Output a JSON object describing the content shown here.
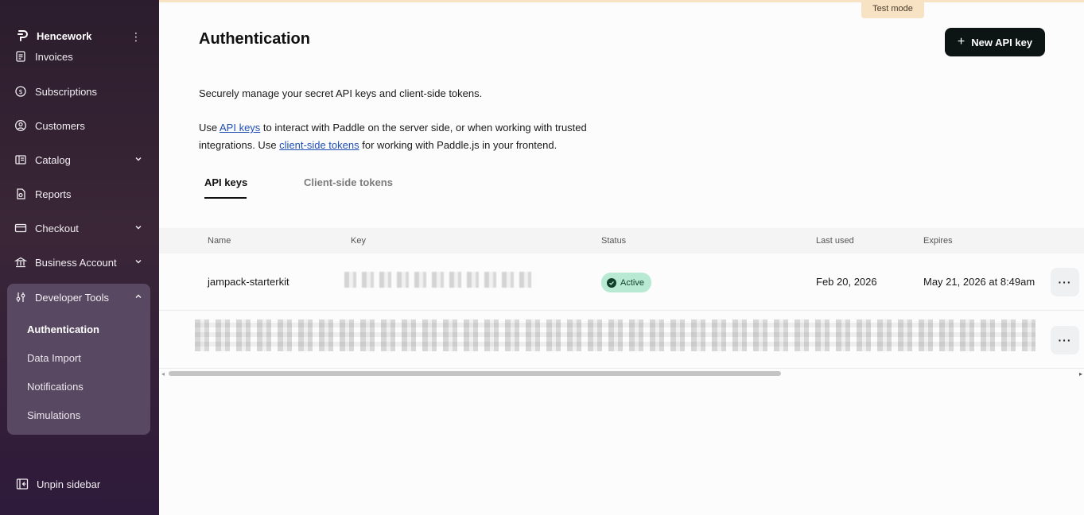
{
  "sidebar": {
    "brand": "Hencework",
    "items": [
      {
        "label": "Invoices"
      },
      {
        "label": "Subscriptions"
      },
      {
        "label": "Customers"
      },
      {
        "label": "Catalog"
      },
      {
        "label": "Reports"
      },
      {
        "label": "Checkout"
      },
      {
        "label": "Business Account"
      },
      {
        "label": "Developer Tools"
      }
    ],
    "sub_items": [
      {
        "label": "Authentication"
      },
      {
        "label": "Data Import"
      },
      {
        "label": "Notifications"
      },
      {
        "label": "Simulations"
      }
    ],
    "unpin_label": "Unpin sidebar"
  },
  "header": {
    "test_mode": "Test mode",
    "title": "Authentication",
    "new_key_button": "New API key"
  },
  "description": {
    "line1": "Securely manage your secret API keys and client-side tokens.",
    "line2_prefix": "Use ",
    "line2_link": "API keys",
    "line2_suffix": " to interact with Paddle on the server side, or when working with trusted",
    "line3_prefix": "integrations. Use ",
    "line3_link": "client-side tokens",
    "line3_suffix": " for working with Paddle.js in your frontend."
  },
  "tabs": [
    {
      "label": "API keys",
      "active": true
    },
    {
      "label": "Client-side tokens",
      "active": false
    }
  ],
  "table": {
    "columns": [
      "Name",
      "Key",
      "Status",
      "Last used",
      "Expires"
    ],
    "rows": [
      {
        "name": "jampack-starterkit",
        "status": "Active",
        "last_used": "Feb 20, 2026",
        "expires": "May 21, 2026 at 8:49am"
      }
    ],
    "more_label": "···"
  },
  "colors": {
    "accent_dark": "#0c1414",
    "status_active_bg": "#b8ead3",
    "test_mode_bg": "#f7e2c3",
    "link": "#1f4fb5"
  }
}
